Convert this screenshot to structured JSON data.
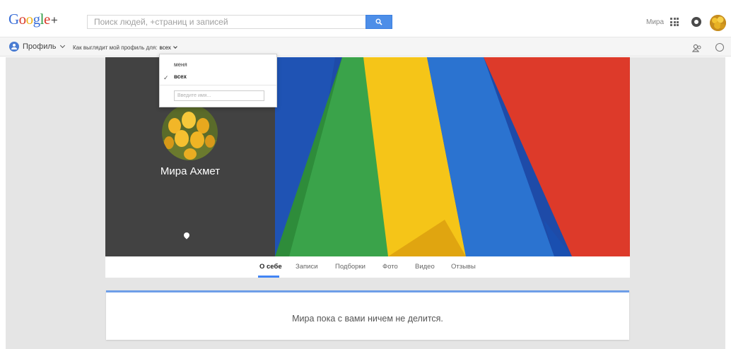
{
  "header": {
    "logo_text": "Google",
    "logo_plus": "+",
    "search_placeholder": "Поиск людей, +страниц и записей",
    "user_name": "Мира"
  },
  "subbar": {
    "profile_label": "Профиль",
    "view_as_label": "Как выглядит мой профиль для:",
    "view_as_value": "всех"
  },
  "dropdown": {
    "options": [
      "меня",
      "всех"
    ],
    "selected": "всех",
    "name_placeholder": "Введите имя..."
  },
  "profile": {
    "name": "Мира Ахмет"
  },
  "tabs": [
    "О себе",
    "Записи",
    "Подборки",
    "Фото",
    "Видео",
    "Отзывы"
  ],
  "active_tab": "О себе",
  "empty_message": "Мира пока с вами ничем не делится.",
  "colors": {
    "accent": "#4285f4",
    "cover_green": "#3aa34a",
    "cover_yellow": "#f5c518",
    "cover_blue": "#2b73d0",
    "cover_red": "#dd3a2a"
  }
}
